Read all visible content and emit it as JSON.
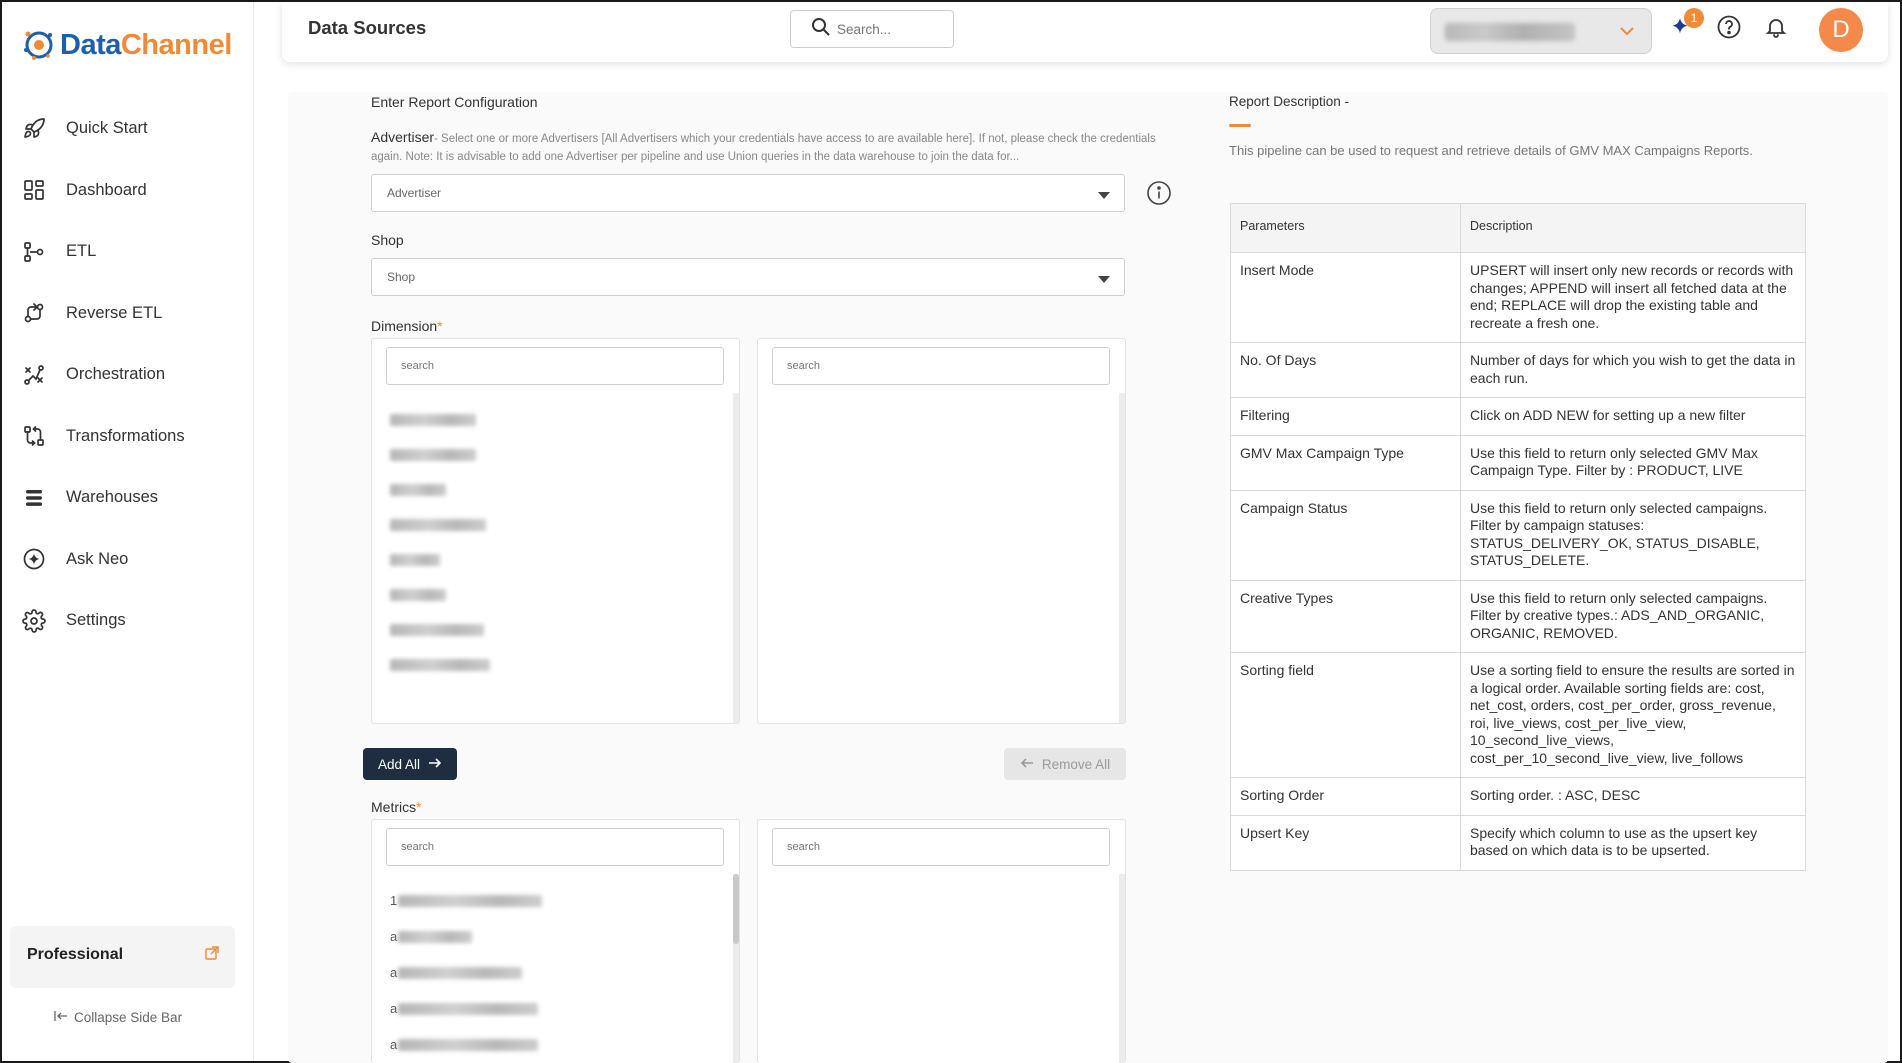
{
  "brand": {
    "name_part1": "Data",
    "name_part2": "Channel",
    "primary": "#1f5fa8",
    "accent": "#f08a36"
  },
  "sidebar": {
    "items": [
      {
        "label": "Quick Start",
        "icon": "rocket-icon"
      },
      {
        "label": "Dashboard",
        "icon": "dashboard-icon"
      },
      {
        "label": "ETL",
        "icon": "etl-icon"
      },
      {
        "label": "Reverse ETL",
        "icon": "reverse-etl-icon"
      },
      {
        "label": "Orchestration",
        "icon": "orchestration-icon"
      },
      {
        "label": "Transformations",
        "icon": "transformations-icon"
      },
      {
        "label": "Warehouses",
        "icon": "warehouses-icon"
      },
      {
        "label": "Ask Neo",
        "icon": "sparkle-icon"
      },
      {
        "label": "Settings",
        "icon": "gear-icon"
      }
    ],
    "plan": "Professional",
    "collapse_label": "Collapse Side Bar"
  },
  "header": {
    "title": "Data Sources",
    "search_placeholder": "Search...",
    "notifications_badge": "1",
    "avatar_initial": "D"
  },
  "form": {
    "section_title": "Enter Report Configuration",
    "advertiser": {
      "label": "Advertiser",
      "help": "- Select one or more Advertisers [All Advertisers which your credentials have access to are available here]. If not, please check the credentials again. Note: It is advisable to add one Advertiser per pipeline and use Union queries in the data warehouse to join the data for...",
      "placeholder": "Advertiser"
    },
    "shop": {
      "label": "Shop",
      "placeholder": "Shop"
    },
    "dimension": {
      "label": "Dimension",
      "required_mark": "*",
      "search_left": "search",
      "search_right": "search"
    },
    "add_all": "Add All",
    "remove_all": "Remove All",
    "metrics": {
      "label": "Metrics",
      "required_mark": "*",
      "search_left": "search",
      "search_right": "search",
      "item_prefixes": [
        "1",
        "a",
        "a",
        "a",
        "a"
      ]
    }
  },
  "report": {
    "title": "Report Description -",
    "description": "This pipeline can be used to request and retrieve details of GMV MAX Campaigns Reports.",
    "table_headers": [
      "Parameters",
      "Description"
    ],
    "rows": [
      {
        "param": "Insert Mode",
        "desc": "UPSERT will insert only new records or records with changes; APPEND will insert all fetched data at the end; REPLACE will drop the existing table and recreate a fresh one."
      },
      {
        "param": "No. Of Days",
        "desc": "Number of days for which you wish to get the data in each run."
      },
      {
        "param": "Filtering",
        "desc": "Click on ADD NEW for setting up a new filter"
      },
      {
        "param": "GMV Max Campaign Type",
        "desc": "Use this field to return only selected GMV Max Campaign Type. Filter by : PRODUCT, LIVE"
      },
      {
        "param": "Campaign Status",
        "desc": "Use this field to return only selected campaigns. Filter by campaign statuses: STATUS_DELIVERY_OK, STATUS_DISABLE, STATUS_DELETE."
      },
      {
        "param": "Creative Types",
        "desc": "Use this field to return only selected campaigns. Filter by creative types.: ADS_AND_ORGANIC, ORGANIC, REMOVED."
      },
      {
        "param": "Sorting field",
        "desc": "Use a sorting field to ensure the results are sorted in a logical order. Available sorting fields are: cost, net_cost, orders, cost_per_order, gross_revenue, roi, live_views, cost_per_live_view, 10_second_live_views, cost_per_10_second_live_view, live_follows"
      },
      {
        "param": "Sorting Order",
        "desc": "Sorting order. : ASC, DESC"
      },
      {
        "param": "Upsert Key",
        "desc": "Specify which column to use as the upsert key based on which data is to be upserted."
      }
    ]
  }
}
